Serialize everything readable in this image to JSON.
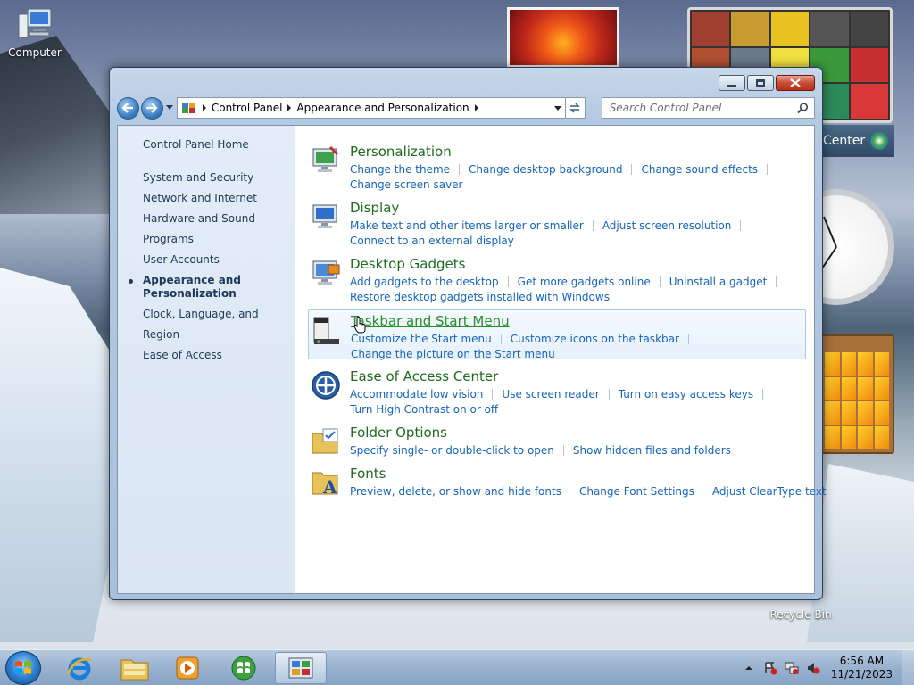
{
  "desktop": {
    "icons": [
      {
        "label": "Computer",
        "icon": "computer-icon"
      },
      {
        "label": "Recycle Bin",
        "icon": "recycle-bin-icon"
      }
    ],
    "gadgets": {
      "media_center_text": "Center"
    }
  },
  "window": {
    "breadcrumbs": [
      "Control Panel",
      "Appearance and Personalization"
    ],
    "search_placeholder": "Search Control Panel",
    "sidebar": {
      "home": "Control Panel Home",
      "items": [
        {
          "label": "System and Security",
          "active": false
        },
        {
          "label": "Network and Internet",
          "active": false
        },
        {
          "label": "Hardware and Sound",
          "active": false
        },
        {
          "label": "Programs",
          "active": false
        },
        {
          "label": "User Accounts",
          "active": false
        },
        {
          "label": "Appearance and Personalization",
          "active": true
        },
        {
          "label": "Clock, Language, and Region",
          "active": false
        },
        {
          "label": "Ease of Access",
          "active": false
        }
      ]
    },
    "categories": [
      {
        "title": "Personalization",
        "icon": "personalization-icon",
        "rows": [
          [
            "Change the theme",
            "Change desktop background",
            "Change sound effects"
          ],
          [
            "Change screen saver"
          ]
        ]
      },
      {
        "title": "Display",
        "icon": "display-icon",
        "rows": [
          [
            "Make text and other items larger or smaller",
            "Adjust screen resolution"
          ],
          [
            "Connect to an external display"
          ]
        ]
      },
      {
        "title": "Desktop Gadgets",
        "icon": "gadgets-icon",
        "rows": [
          [
            "Add gadgets to the desktop",
            "Get more gadgets online",
            "Uninstall a gadget"
          ],
          [
            "Restore desktop gadgets installed with Windows"
          ]
        ]
      },
      {
        "title": "Taskbar and Start Menu",
        "icon": "taskbar-icon",
        "hovered": true,
        "rows": [
          [
            "Customize the Start menu",
            "Customize icons on the taskbar"
          ],
          [
            "Change the picture on the Start menu"
          ]
        ]
      },
      {
        "title": "Ease of Access Center",
        "icon": "ease-of-access-icon",
        "rows": [
          [
            "Accommodate low vision",
            "Use screen reader",
            "Turn on easy access keys"
          ],
          [
            "Turn High Contrast on or off"
          ]
        ]
      },
      {
        "title": "Folder Options",
        "icon": "folder-options-icon",
        "rows": [
          [
            "Specify single- or double-click to open",
            "Show hidden files and folders"
          ]
        ]
      },
      {
        "title": "Fonts",
        "icon": "fonts-icon",
        "rows": [
          [
            "Preview, delete, or show and hide fonts",
            "Change Font Settings",
            "Adjust ClearType text"
          ]
        ]
      }
    ]
  },
  "taskbar": {
    "pinned": [
      "internet-explorer-icon",
      "windows-explorer-icon",
      "media-player-icon",
      "media-center-icon",
      "control-panel-icon"
    ],
    "clock": {
      "time": "6:56 AM",
      "date": "11/21/2023"
    }
  },
  "colors": {
    "link": "#1665ba",
    "category_title": "#1e6b1e",
    "sidebar_text": "#1e395b"
  }
}
